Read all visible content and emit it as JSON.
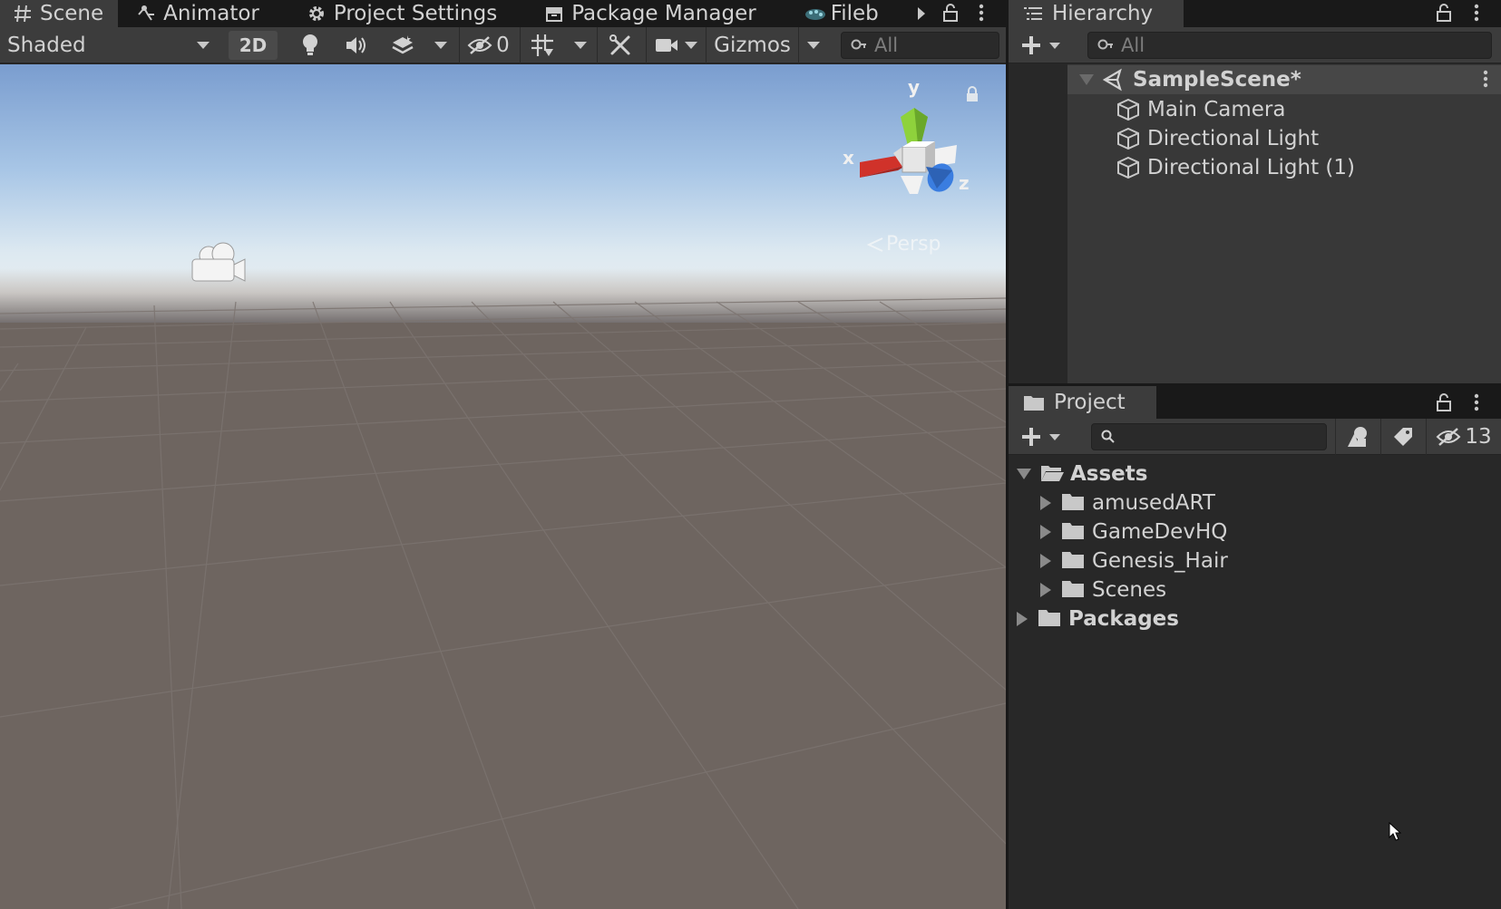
{
  "scene_window": {
    "tabs": [
      {
        "label": "Scene",
        "icon": "grid-hash-icon",
        "active": true
      },
      {
        "label": "Animator",
        "icon": "animator-icon",
        "active": false
      },
      {
        "label": "Project Settings",
        "icon": "gear-icon",
        "active": false
      },
      {
        "label": "Package Manager",
        "icon": "package-icon",
        "active": false
      },
      {
        "label": "Fileb",
        "icon": "filebase-icon",
        "active": false
      }
    ],
    "toolbar": {
      "draw_mode": "Shaded",
      "mode_2d": "2D",
      "hidden_count": "0",
      "gizmos": "Gizmos",
      "search_placeholder": "All"
    },
    "viewport": {
      "axis_x": "x",
      "axis_y": "y",
      "axis_z": "z",
      "projection_label": "Persp",
      "colors": {
        "x_axis": "#d0322a",
        "y_axis": "#8ed23c",
        "z_axis": "#3a7de0",
        "sky": "#a8c6e6",
        "ground": "#6e6560"
      }
    }
  },
  "hierarchy": {
    "tab_label": "Hierarchy",
    "search_placeholder": "All",
    "scene_name": "SampleScene*",
    "items": [
      {
        "label": "Main Camera",
        "icon": "gameobject-cube-icon"
      },
      {
        "label": "Directional Light",
        "icon": "gameobject-cube-icon"
      },
      {
        "label": "Directional Light (1)",
        "icon": "gameobject-cube-icon"
      }
    ]
  },
  "project": {
    "tab_label": "Project",
    "search_value": "",
    "hidden_packages_count": "13",
    "tree": {
      "root": "Assets",
      "children": [
        "amusedART",
        "GameDevHQ",
        "Genesis_Hair",
        "Scenes"
      ],
      "sibling_root": "Packages"
    }
  }
}
